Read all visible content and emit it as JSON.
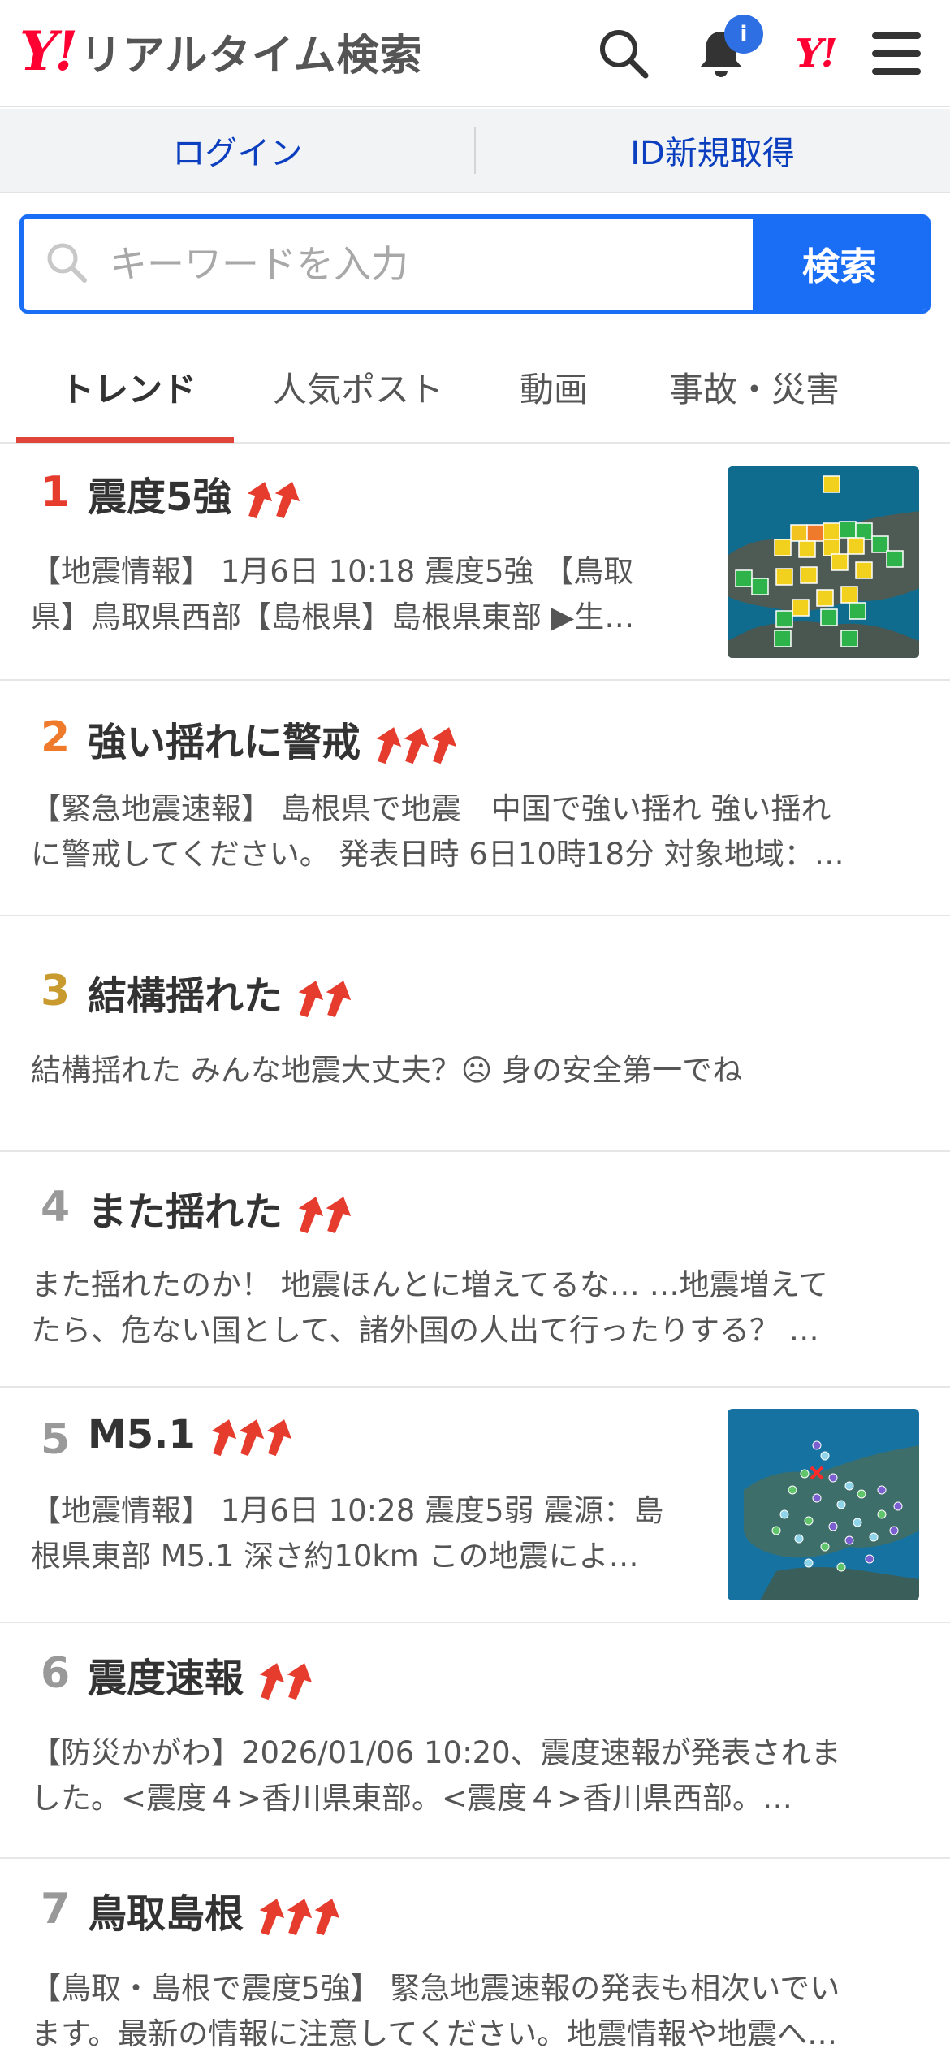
{
  "header": {
    "logo_y": "Y!",
    "logo_text": "リアルタイム検索",
    "notification_badge": "i",
    "yj_logo": "Y!"
  },
  "login": {
    "login_label": "ログイン",
    "register_label": "ID新規取得"
  },
  "search": {
    "placeholder": "キーワードを入力",
    "value": "",
    "button_label": "検索"
  },
  "tabs": [
    {
      "label": "トレンド",
      "active": true
    },
    {
      "label": "人気ポスト",
      "active": false
    },
    {
      "label": "動画",
      "active": false
    },
    {
      "label": "事故・災害",
      "active": false
    }
  ],
  "trends": [
    {
      "rank": "1",
      "rank_color": "#e53c2e",
      "title": "震度5強",
      "arrows": 2,
      "has_thumb": true,
      "thumb": "map-intensity",
      "desc_lines": [
        "【地震情報】 1月6日 10:18 震度5強 【鳥取",
        "県】鳥取県西部【島根県】島根県東部 ▶生…"
      ]
    },
    {
      "rank": "2",
      "rank_color": "#f07a2b",
      "title": "強い揺れに警戒",
      "arrows": 3,
      "has_thumb": false,
      "desc_lines": [
        "【緊急地震速報】 島根県で地震　中国で強い揺れ 強い揺れ",
        "に警戒してください。 発表日時 6日10時18分 対象地域：…"
      ]
    },
    {
      "rank": "3",
      "rank_color": "#c99a2e",
      "title": "結構揺れた",
      "arrows": 2,
      "has_thumb": false,
      "desc_lines": [
        "結構揺れた みんな地震大丈夫？☹ 身の安全第一でね"
      ]
    },
    {
      "rank": "4",
      "rank_color": "#999999",
      "title": "また揺れた",
      "arrows": 2,
      "has_thumb": false,
      "desc_lines": [
        "また揺れたのか！ 地震ほんとに増えてるな… …地震増えて",
        "たら、危ない国として、諸外国の人出て行ったりする？ …"
      ]
    },
    {
      "rank": "5",
      "rank_color": "#999999",
      "title": "M5.1",
      "arrows": 3,
      "has_thumb": true,
      "thumb": "map-epicenter",
      "desc_lines": [
        "【地震情報】 1月6日 10:28 震度5弱 震源：島",
        "根県東部 M5.1 深さ約10km この地震によ…"
      ]
    },
    {
      "rank": "6",
      "rank_color": "#999999",
      "title": "震度速報",
      "arrows": 2,
      "has_thumb": false,
      "desc_lines": [
        "【防災かがわ】2026/01/06 10:20、震度速報が発表されま",
        "した。<震度４>香川県東部。<震度４>香川県西部。…"
      ]
    },
    {
      "rank": "7",
      "rank_color": "#999999",
      "title": "鳥取島根",
      "arrows": 3,
      "has_thumb": false,
      "desc_lines": [
        "【鳥取・島根で震度5強】 緊急地震速報の発表も相次いでい",
        "ます。最新の情報に注意してください。地震情報や地震へ…"
      ]
    }
  ],
  "colors": {
    "accent": "#1a6ef5",
    "brand": "#ff0033",
    "tab_underline": "#e0453a",
    "arrow": "#e53c2e"
  }
}
